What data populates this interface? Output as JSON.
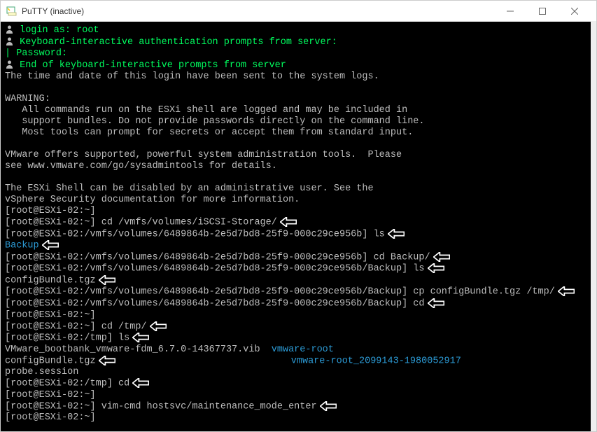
{
  "window": {
    "title": "PuTTY (inactive)"
  },
  "lines": [
    {
      "segs": [
        {
          "icon": "user"
        },
        {
          "t": " login as: root",
          "c": "green"
        }
      ],
      "arrow": false
    },
    {
      "segs": [
        {
          "icon": "user"
        },
        {
          "t": " Keyboard-interactive authentication prompts from server:",
          "c": "green"
        }
      ],
      "arrow": false
    },
    {
      "segs": [
        {
          "t": "| Password:",
          "c": "green"
        }
      ],
      "arrow": false
    },
    {
      "segs": [
        {
          "icon": "user"
        },
        {
          "t": " End of keyboard-interactive prompts from server",
          "c": "green"
        }
      ],
      "arrow": false
    },
    {
      "segs": [
        {
          "t": "The time and date of this login have been sent to the system logs.",
          "c": "grey"
        }
      ],
      "arrow": false
    },
    {
      "segs": [
        {
          "t": " ",
          "c": "grey"
        }
      ],
      "arrow": false
    },
    {
      "segs": [
        {
          "t": "WARNING:",
          "c": "grey"
        }
      ],
      "arrow": false
    },
    {
      "segs": [
        {
          "t": "   All commands run on the ESXi shell are logged and may be included in",
          "c": "grey"
        }
      ],
      "arrow": false
    },
    {
      "segs": [
        {
          "t": "   support bundles. Do not provide passwords directly on the command line.",
          "c": "grey"
        }
      ],
      "arrow": false
    },
    {
      "segs": [
        {
          "t": "   Most tools can prompt for secrets or accept them from standard input.",
          "c": "grey"
        }
      ],
      "arrow": false
    },
    {
      "segs": [
        {
          "t": " ",
          "c": "grey"
        }
      ],
      "arrow": false
    },
    {
      "segs": [
        {
          "t": "VMware offers supported, powerful system administration tools.  Please",
          "c": "grey"
        }
      ],
      "arrow": false
    },
    {
      "segs": [
        {
          "t": "see www.vmware.com/go/sysadmintools for details.",
          "c": "grey"
        }
      ],
      "arrow": false
    },
    {
      "segs": [
        {
          "t": " ",
          "c": "grey"
        }
      ],
      "arrow": false
    },
    {
      "segs": [
        {
          "t": "The ESXi Shell can be disabled by an administrative user. See the",
          "c": "grey"
        }
      ],
      "arrow": false
    },
    {
      "segs": [
        {
          "t": "vSphere Security documentation for more information.",
          "c": "grey"
        }
      ],
      "arrow": false
    },
    {
      "segs": [
        {
          "t": "[root@ESXi-02:~]",
          "c": "grey"
        }
      ],
      "arrow": false
    },
    {
      "segs": [
        {
          "t": "[root@ESXi-02:~] cd /vmfs/volumes/iSCSI-Storage/",
          "c": "grey"
        }
      ],
      "arrow": true
    },
    {
      "segs": [
        {
          "t": "[root@ESXi-02:/vmfs/volumes/6489864b-2e5d7bd8-25f9-000c29ce956b] ls",
          "c": "grey"
        }
      ],
      "arrow": true
    },
    {
      "segs": [
        {
          "t": "Backup",
          "c": "cyan"
        }
      ],
      "arrow": true
    },
    {
      "segs": [
        {
          "t": "[root@ESXi-02:/vmfs/volumes/6489864b-2e5d7bd8-25f9-000c29ce956b] cd Backup/",
          "c": "grey"
        }
      ],
      "arrow": true
    },
    {
      "segs": [
        {
          "t": "[root@ESXi-02:/vmfs/volumes/6489864b-2e5d7bd8-25f9-000c29ce956b/Backup] ls",
          "c": "grey"
        }
      ],
      "arrow": true
    },
    {
      "segs": [
        {
          "t": "configBundle.tgz",
          "c": "grey"
        }
      ],
      "arrow": true
    },
    {
      "segs": [
        {
          "t": "[root@ESXi-02:/vmfs/volumes/6489864b-2e5d7bd8-25f9-000c29ce956b/Backup] cp configBundle.tgz /tmp/",
          "c": "grey"
        }
      ],
      "arrow": true
    },
    {
      "segs": [
        {
          "t": "[root@ESXi-02:/vmfs/volumes/6489864b-2e5d7bd8-25f9-000c29ce956b/Backup] cd",
          "c": "grey"
        }
      ],
      "arrow": true
    },
    {
      "segs": [
        {
          "t": "[root@ESXi-02:~]",
          "c": "grey"
        }
      ],
      "arrow": false
    },
    {
      "segs": [
        {
          "t": "[root@ESXi-02:~] cd /tmp/",
          "c": "grey"
        }
      ],
      "arrow": true
    },
    {
      "segs": [
        {
          "t": "[root@ESXi-02:/tmp] ls",
          "c": "grey"
        }
      ],
      "arrow": true
    },
    {
      "segs": [
        {
          "t": "VMware_bootbank_vmware-fdm_6.7.0-14367737.vib  ",
          "c": "grey"
        },
        {
          "t": "vmware-root",
          "c": "cyan"
        }
      ],
      "arrow": false
    },
    {
      "segs": [
        {
          "t": "configBundle.tgz",
          "c": "grey"
        },
        {
          "t": "                               ",
          "c": "grey"
        },
        {
          "t": "vmware-root_2099143-1980052917",
          "c": "cyan"
        }
      ],
      "arrow": true,
      "arrowAfterFirst": true
    },
    {
      "segs": [
        {
          "t": "probe.session",
          "c": "grey"
        }
      ],
      "arrow": false
    },
    {
      "segs": [
        {
          "t": "[root@ESXi-02:/tmp] cd",
          "c": "grey"
        }
      ],
      "arrow": true
    },
    {
      "segs": [
        {
          "t": "[root@ESXi-02:~]",
          "c": "grey"
        }
      ],
      "arrow": false
    },
    {
      "segs": [
        {
          "t": "[root@ESXi-02:~] vim-cmd hostsvc/maintenance_mode_enter",
          "c": "grey"
        }
      ],
      "arrow": true
    },
    {
      "segs": [
        {
          "t": "[root@ESXi-02:~]",
          "c": "grey"
        }
      ],
      "arrow": false
    }
  ]
}
